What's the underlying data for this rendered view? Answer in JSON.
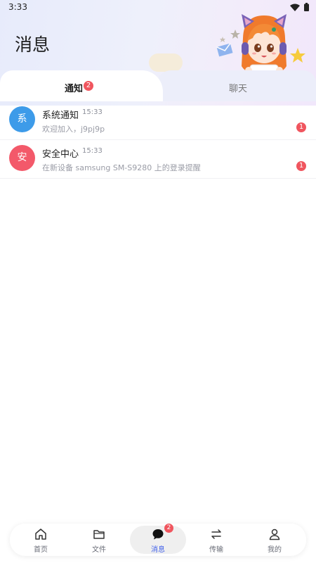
{
  "status_bar": {
    "time": "3:33"
  },
  "header": {
    "title": "消息"
  },
  "tabs": [
    {
      "label": "通知",
      "badge": "2",
      "active": true
    },
    {
      "label": "聊天",
      "active": false
    }
  ],
  "notifications": [
    {
      "avatar_char": "系",
      "avatar_color": "#3d9be9",
      "title": "系统通知",
      "time": "15:33",
      "preview": "欢迎加入，j9pj9p",
      "unread": "1"
    },
    {
      "avatar_char": "安",
      "avatar_color": "#f3596a",
      "title": "安全中心",
      "time": "15:33",
      "preview": "在新设备 samsung SM-S9280 上的登录提醒",
      "unread": "1"
    }
  ],
  "bottom_nav": {
    "items": [
      {
        "label": "首页",
        "icon": "home-icon"
      },
      {
        "label": "文件",
        "icon": "folder-icon"
      },
      {
        "label": "消息",
        "icon": "chat-bubble-icon",
        "badge": "2",
        "active": true
      },
      {
        "label": "传输",
        "icon": "transfer-icon"
      },
      {
        "label": "我的",
        "icon": "user-icon"
      }
    ]
  },
  "colors": {
    "accent": "#4363ea",
    "badge": "#f0555e"
  }
}
